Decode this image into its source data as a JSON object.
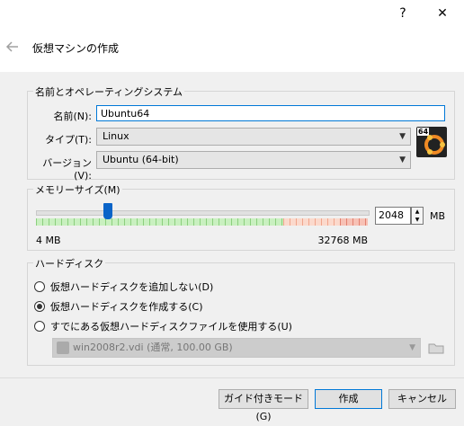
{
  "window": {
    "help": "?",
    "close": "✕"
  },
  "header": {
    "back_icon": "arrow-left-icon",
    "title": "仮想マシンの作成"
  },
  "name_os": {
    "legend": "名前とオペレーティングシステム",
    "name_label": "名前(N):",
    "name_value": "Ubuntu64",
    "type_label": "タイプ(T):",
    "type_value": "Linux",
    "version_label": "バージョン(V):",
    "version_value": "Ubuntu (64-bit)",
    "os_badge": "64"
  },
  "memory": {
    "legend": "メモリーサイズ(M)",
    "value": "2048",
    "unit": "MB",
    "min_label": "4 MB",
    "max_label": "32768 MB",
    "min": 4,
    "max": 32768,
    "current": 2048
  },
  "disk": {
    "legend": "ハードディスク",
    "opt_none": "仮想ハードディスクを追加しない(D)",
    "opt_create": "仮想ハードディスクを作成する(C)",
    "opt_existing": "すでにある仮想ハードディスクファイルを使用する(U)",
    "existing_file": "win2008r2.vdi (通常, 100.00 GB)",
    "selected": "create"
  },
  "footer": {
    "guided": "ガイド付きモード(G)",
    "create": "作成",
    "cancel": "キャンセル"
  }
}
